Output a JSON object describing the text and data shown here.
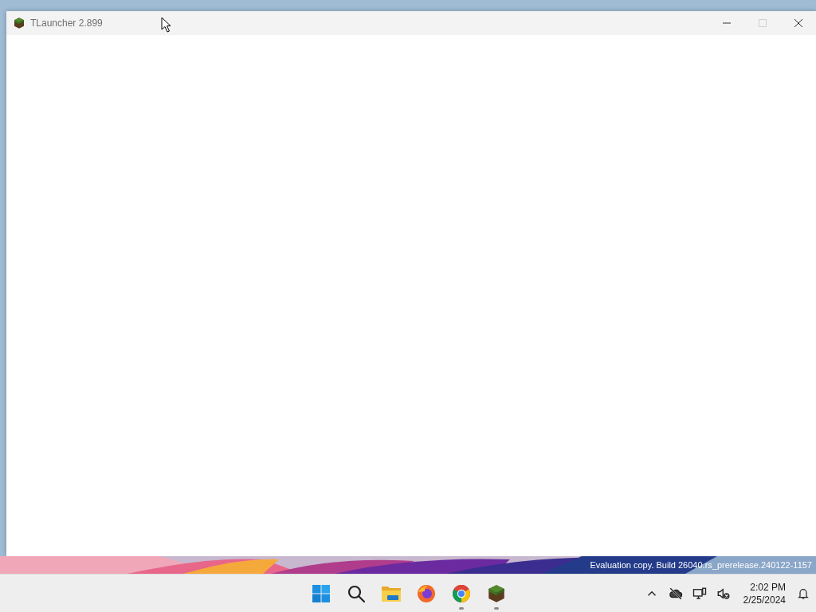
{
  "window": {
    "title": "TLauncher 2.899",
    "controls": [
      {
        "kind": "minimize",
        "disabled": false
      },
      {
        "kind": "maximize",
        "disabled": true
      },
      {
        "kind": "close",
        "disabled": false
      }
    ]
  },
  "watermark": "Evaluation copy. Build 26040.rs_prerelease.240122-1157",
  "taskbar": {
    "apps": [
      {
        "kind": "start",
        "running": false
      },
      {
        "kind": "search",
        "running": false
      },
      {
        "kind": "folder",
        "running": false
      },
      {
        "kind": "firefox",
        "running": false
      },
      {
        "kind": "chrome",
        "running": true
      },
      {
        "kind": "grass-block",
        "running": true
      }
    ],
    "tray": [
      {
        "kind": "chevron"
      },
      {
        "kind": "cloud-off"
      },
      {
        "kind": "network"
      },
      {
        "kind": "volume-muted"
      }
    ],
    "clock": {
      "time": "2:02 PM",
      "date": "2/25/2024"
    }
  }
}
